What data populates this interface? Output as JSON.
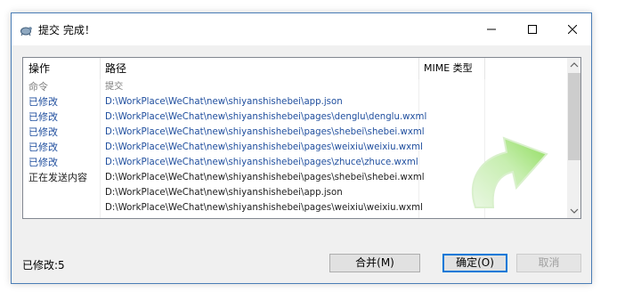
{
  "window": {
    "title": "提交 完成！"
  },
  "list": {
    "columns": [
      "操作",
      "路径",
      "MIME 类型"
    ],
    "rows": [
      {
        "action": "命令",
        "path": "提交",
        "style": "gray"
      },
      {
        "action": "已修改",
        "path": "D:\\WorkPlace\\WeChat\\new\\shiyanshishebei\\app.json",
        "style": "blue"
      },
      {
        "action": "已修改",
        "path": "D:\\WorkPlace\\WeChat\\new\\shiyanshishebei\\pages\\denglu\\denglu.wxml",
        "style": "blue"
      },
      {
        "action": "已修改",
        "path": "D:\\WorkPlace\\WeChat\\new\\shiyanshishebei\\pages\\shebei\\shebei.wxml",
        "style": "blue"
      },
      {
        "action": "已修改",
        "path": "D:\\WorkPlace\\WeChat\\new\\shiyanshishebei\\pages\\weixiu\\weixiu.wxml",
        "style": "blue"
      },
      {
        "action": "已修改",
        "path": "D:\\WorkPlace\\WeChat\\new\\shiyanshishebei\\pages\\zhuce\\zhuce.wxml",
        "style": "blue"
      },
      {
        "action": "正在发送内容",
        "path": "D:\\WorkPlace\\WeChat\\new\\shiyanshishebei\\pages\\shebei\\shebei.wxml",
        "style": "dark"
      },
      {
        "action": "",
        "path": "D:\\WorkPlace\\WeChat\\new\\shiyanshishebei\\app.json",
        "style": "dark"
      },
      {
        "action": "",
        "path": "D:\\WorkPlace\\WeChat\\new\\shiyanshishebei\\pages\\weixiu\\weixiu.wxml",
        "style": "dark"
      }
    ]
  },
  "status": {
    "text": "已修改:5"
  },
  "buttons": {
    "merge": "合并(M)",
    "ok": "确定(O)",
    "cancel": "取消"
  },
  "colors": {
    "accent": "#0078d7",
    "modified": "#1f4e9e",
    "arrow": "#9be06a"
  },
  "icons": [
    "tortoise-icon",
    "minimize-icon",
    "maximize-icon",
    "close-icon",
    "success-arrow-icon"
  ]
}
